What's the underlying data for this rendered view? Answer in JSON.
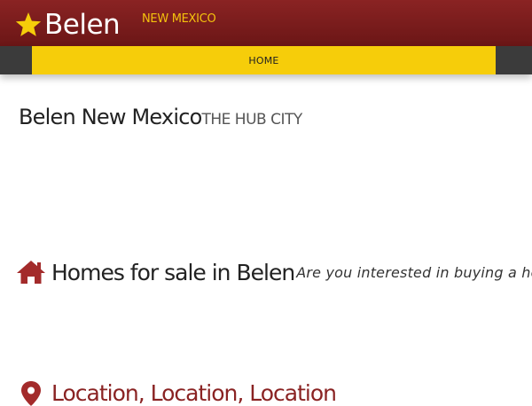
{
  "header": {
    "logo_text": "Belen",
    "tagline": "NEW MEXICO"
  },
  "nav": {
    "items": [
      {
        "label": "HOME"
      }
    ]
  },
  "page": {
    "site_name": "Belen New Mexico",
    "subtitle": "THE HUB CITY"
  },
  "sections": [
    {
      "icon": "home-icon",
      "title": "Homes for sale in Belen",
      "lead": "Are you interested in buying a hom"
    },
    {
      "icon": "map-marker-icon",
      "title": "Location, Location, Location"
    }
  ],
  "colors": {
    "header_bg": "#7a1c1c",
    "accent_yellow": "#f6cd0a",
    "nav_strip": "#3b3b3b",
    "icon_red": "#a32b2b"
  }
}
